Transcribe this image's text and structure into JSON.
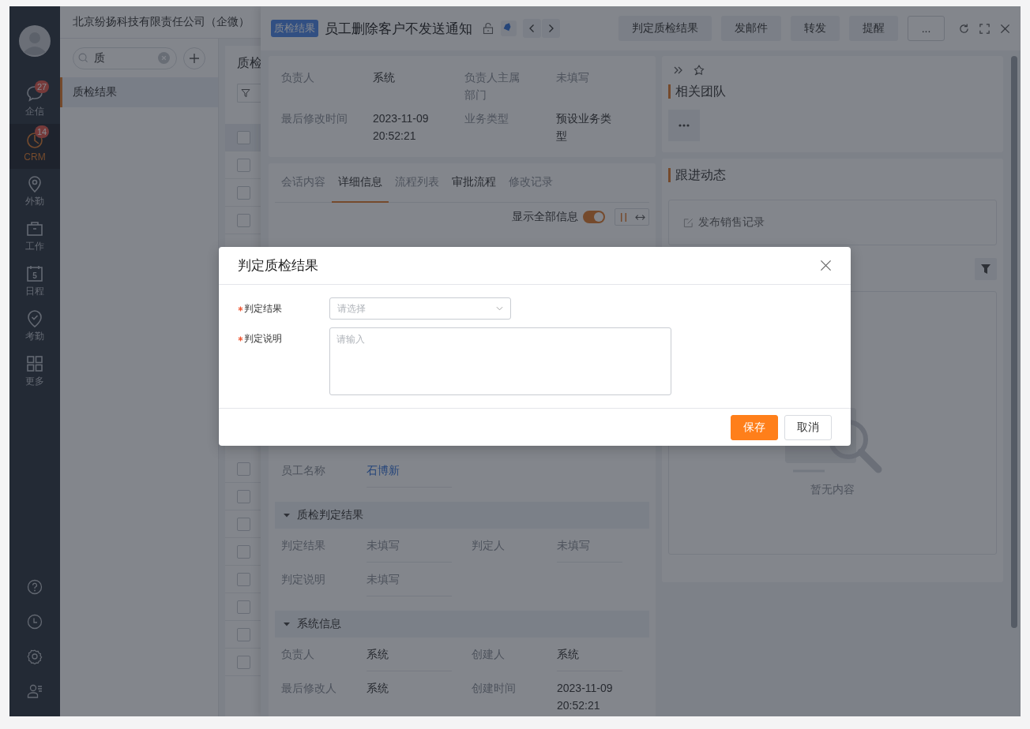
{
  "nav": {
    "items": [
      {
        "label": "企信",
        "badge": "27",
        "selected": false
      },
      {
        "label": "CRM",
        "badge": "14",
        "selected": true
      },
      {
        "label": "外勤",
        "selected": false
      },
      {
        "label": "工作",
        "selected": false
      },
      {
        "label": "日程",
        "icon_text": "5",
        "selected": false
      },
      {
        "label": "考勤",
        "selected": false
      },
      {
        "label": "更多",
        "selected": false
      }
    ]
  },
  "company": "北京纷扬科技有限责任公司（企微）",
  "search": {
    "value": "质"
  },
  "menu": [
    {
      "label": "质检结果",
      "selected": true
    }
  ],
  "list": {
    "title": "质检",
    "header_checked": false,
    "rows": [
      {
        "checked": false
      },
      {
        "checked": false
      },
      {
        "checked": false
      },
      {
        "checked": false
      },
      {
        "checked": false
      },
      {
        "checked": false
      },
      {
        "checked": false
      },
      {
        "checked": false
      },
      {
        "checked": false
      },
      {
        "checked": false
      },
      {
        "checked": false
      }
    ]
  },
  "detail": {
    "tag": "质检结果",
    "title": "员工删除客户不发送通知",
    "actions": [
      {
        "label": "判定质检结果",
        "kind": "filled"
      },
      {
        "label": "发邮件",
        "kind": "filled"
      },
      {
        "label": "转发",
        "kind": "filled"
      },
      {
        "label": "提醒",
        "kind": "filled"
      },
      {
        "label": "...",
        "kind": "outline"
      }
    ],
    "summary": [
      {
        "label": "负责人",
        "value": "系统",
        "kind": "text"
      },
      {
        "label": "负责人主属部门",
        "value": "未填写",
        "kind": "empty"
      },
      {
        "label": "最后修改时间",
        "value": "2023-11-09 20:52:21",
        "kind": "text"
      },
      {
        "label": "业务类型",
        "value": "预设业务类型",
        "kind": "text"
      }
    ],
    "tabs": [
      {
        "label": "会话内容",
        "selected": false,
        "disabled": true
      },
      {
        "label": "详细信息",
        "selected": true,
        "disabled": false
      },
      {
        "label": "流程列表",
        "selected": false,
        "disabled": true
      },
      {
        "label": "审批流程",
        "selected": false,
        "disabled": false
      },
      {
        "label": "修改记录",
        "selected": false,
        "disabled": true
      }
    ],
    "show_all": {
      "label": "显示全部信息",
      "on": true
    },
    "layout_modes": [
      {
        "selected": true
      },
      {
        "selected": false
      }
    ],
    "fields": [
      {
        "label": "员工名称",
        "value": "石博新",
        "kind": "link"
      }
    ],
    "sections": [
      {
        "title": "质检判定结果",
        "expanded": true,
        "fields": [
          {
            "label": "判定结果",
            "value": "未填写",
            "kind": "empty"
          },
          {
            "label": "判定人",
            "value": "未填写",
            "kind": "empty"
          },
          {
            "label": "判定说明",
            "value": "未填写",
            "kind": "empty"
          }
        ]
      },
      {
        "title": "系统信息",
        "expanded": true,
        "fields": [
          {
            "label": "负责人",
            "value": "系统",
            "kind": "text"
          },
          {
            "label": "创建人",
            "value": "系统",
            "kind": "text"
          },
          {
            "label": "最后修改人",
            "value": "系统",
            "kind": "text"
          },
          {
            "label": "创建时间",
            "value": "2023-11-09 20:52:21",
            "kind": "text"
          }
        ]
      }
    ]
  },
  "side": {
    "team_title": "相关团队",
    "follow_title": "跟进动态",
    "post": "发布销售记录",
    "empty": "暂无内容"
  },
  "dialog": {
    "title": "判定质检结果",
    "fields": [
      {
        "label": "判定结果",
        "required": true,
        "kind": "select",
        "placeholder": "请选择"
      },
      {
        "label": "判定说明",
        "required": true,
        "kind": "textarea",
        "placeholder": "请输入"
      }
    ],
    "buttons": [
      {
        "label": "保存",
        "kind": "primary"
      },
      {
        "label": "取消",
        "kind": "default"
      }
    ]
  }
}
